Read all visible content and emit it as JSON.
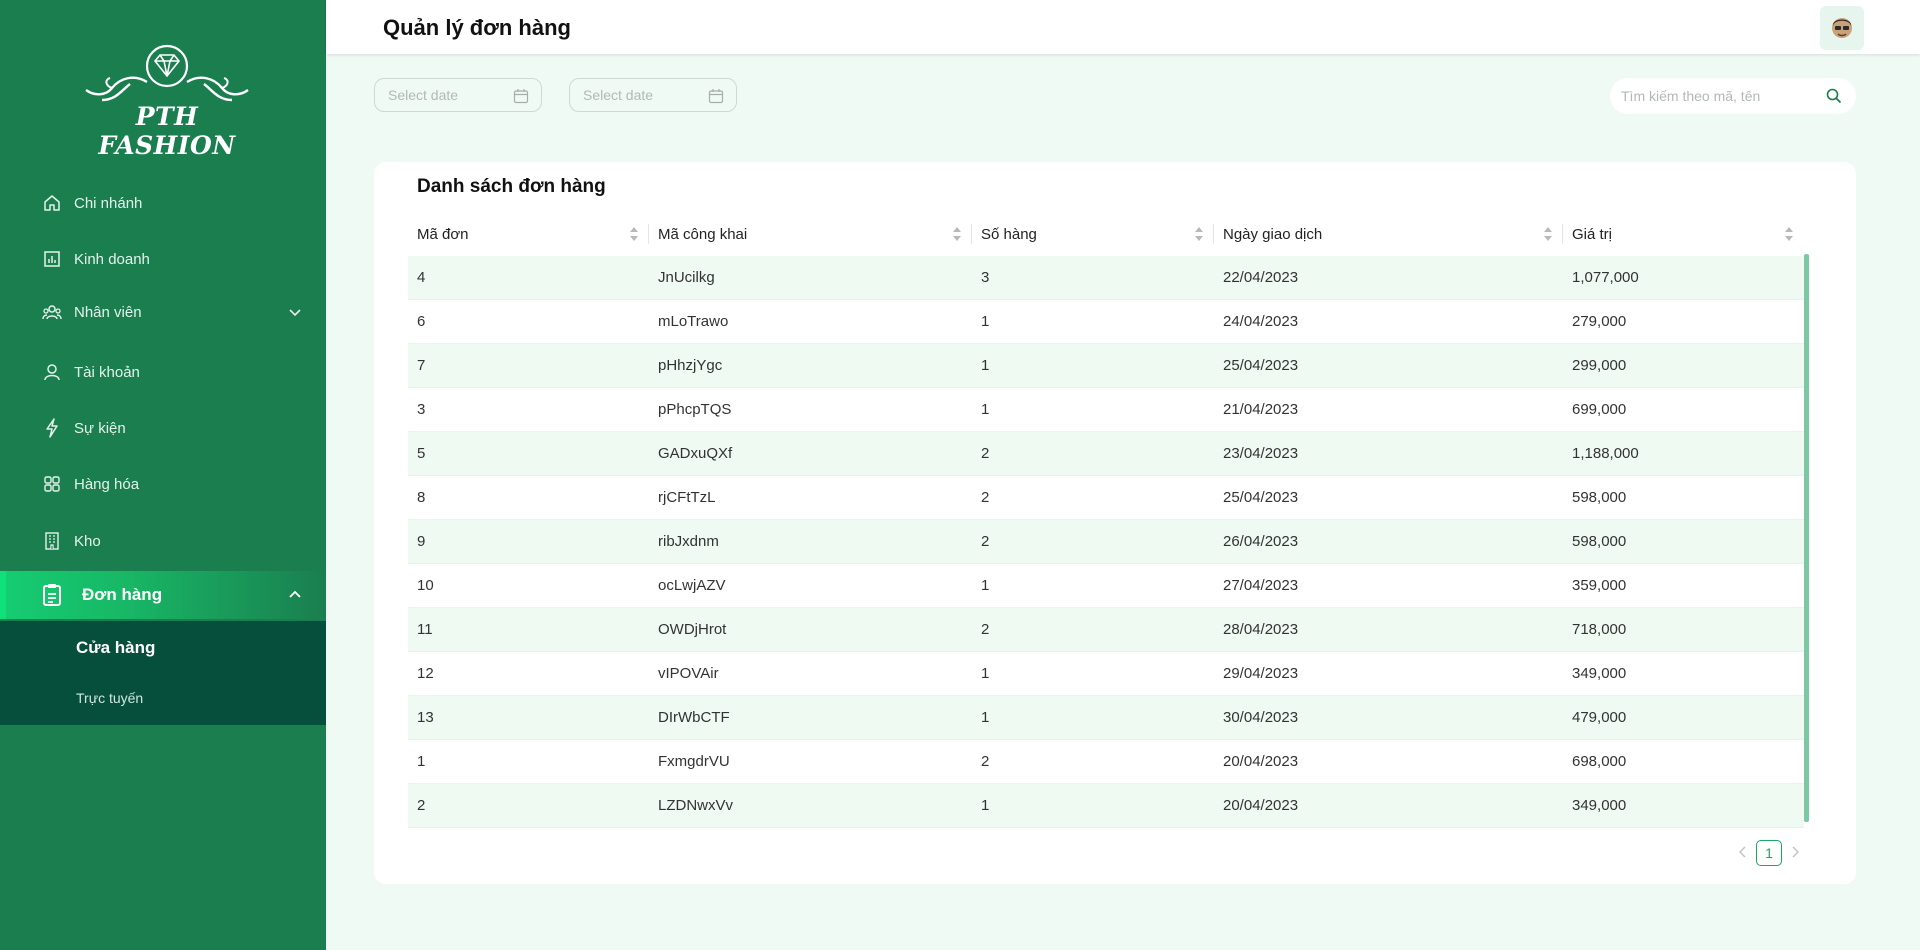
{
  "brand": {
    "logo_text": "PTH FASHION"
  },
  "sidebar": {
    "items": [
      {
        "label": "Chi nhánh",
        "icon": "home-icon"
      },
      {
        "label": "Kinh doanh",
        "icon": "bar-chart-icon"
      },
      {
        "label": "Nhân viên",
        "icon": "users-icon"
      },
      {
        "label": "Tài khoản",
        "icon": "user-icon"
      },
      {
        "label": "Sự kiện",
        "icon": "lightning-icon"
      },
      {
        "label": "Hàng hóa",
        "icon": "grid-icon"
      },
      {
        "label": "Kho",
        "icon": "building-icon"
      },
      {
        "label": "Đơn hàng",
        "icon": "clipboard-icon"
      }
    ],
    "submenu": [
      {
        "label": "Cửa hàng"
      },
      {
        "label": "Trực tuyến"
      }
    ]
  },
  "header": {
    "title": "Quản lý đơn hàng"
  },
  "filters": {
    "date_from_placeholder": "Select date",
    "date_to_placeholder": "Select date",
    "search_placeholder": "Tìm kiếm theo mã, tên"
  },
  "table": {
    "title": "Danh sách đơn hàng",
    "columns": [
      "Mã đơn",
      "Mã công khai",
      "Số hàng",
      "Ngày giao dịch",
      "Giá trị"
    ],
    "rows": [
      [
        "4",
        "JnUcilkg",
        "3",
        "22/04/2023",
        "1,077,000"
      ],
      [
        "6",
        "mLoTrawo",
        "1",
        "24/04/2023",
        "279,000"
      ],
      [
        "7",
        "pHhzjYgc",
        "1",
        "25/04/2023",
        "299,000"
      ],
      [
        "3",
        "pPhcpTQS",
        "1",
        "21/04/2023",
        "699,000"
      ],
      [
        "5",
        "GADxuQXf",
        "2",
        "23/04/2023",
        "1,188,000"
      ],
      [
        "8",
        "rjCFtTzL",
        "2",
        "25/04/2023",
        "598,000"
      ],
      [
        "9",
        "ribJxdnm",
        "2",
        "26/04/2023",
        "598,000"
      ],
      [
        "10",
        "ocLwjAZV",
        "1",
        "27/04/2023",
        "359,000"
      ],
      [
        "11",
        "OWDjHrot",
        "2",
        "28/04/2023",
        "718,000"
      ],
      [
        "12",
        "vIPOVAir",
        "1",
        "29/04/2023",
        "349,000"
      ],
      [
        "13",
        "DIrWbCTF",
        "1",
        "30/04/2023",
        "479,000"
      ],
      [
        "1",
        "FxmgdrVU",
        "2",
        "20/04/2023",
        "698,000"
      ],
      [
        "2",
        "LZDNwxVv",
        "1",
        "20/04/2023",
        "349,000"
      ]
    ]
  },
  "pagination": {
    "current_page": "1"
  },
  "colors": {
    "sidebar": "#1a7e4f",
    "accent": "#1aa766",
    "submenu": "#064f3c",
    "background": "#f0faf5"
  }
}
